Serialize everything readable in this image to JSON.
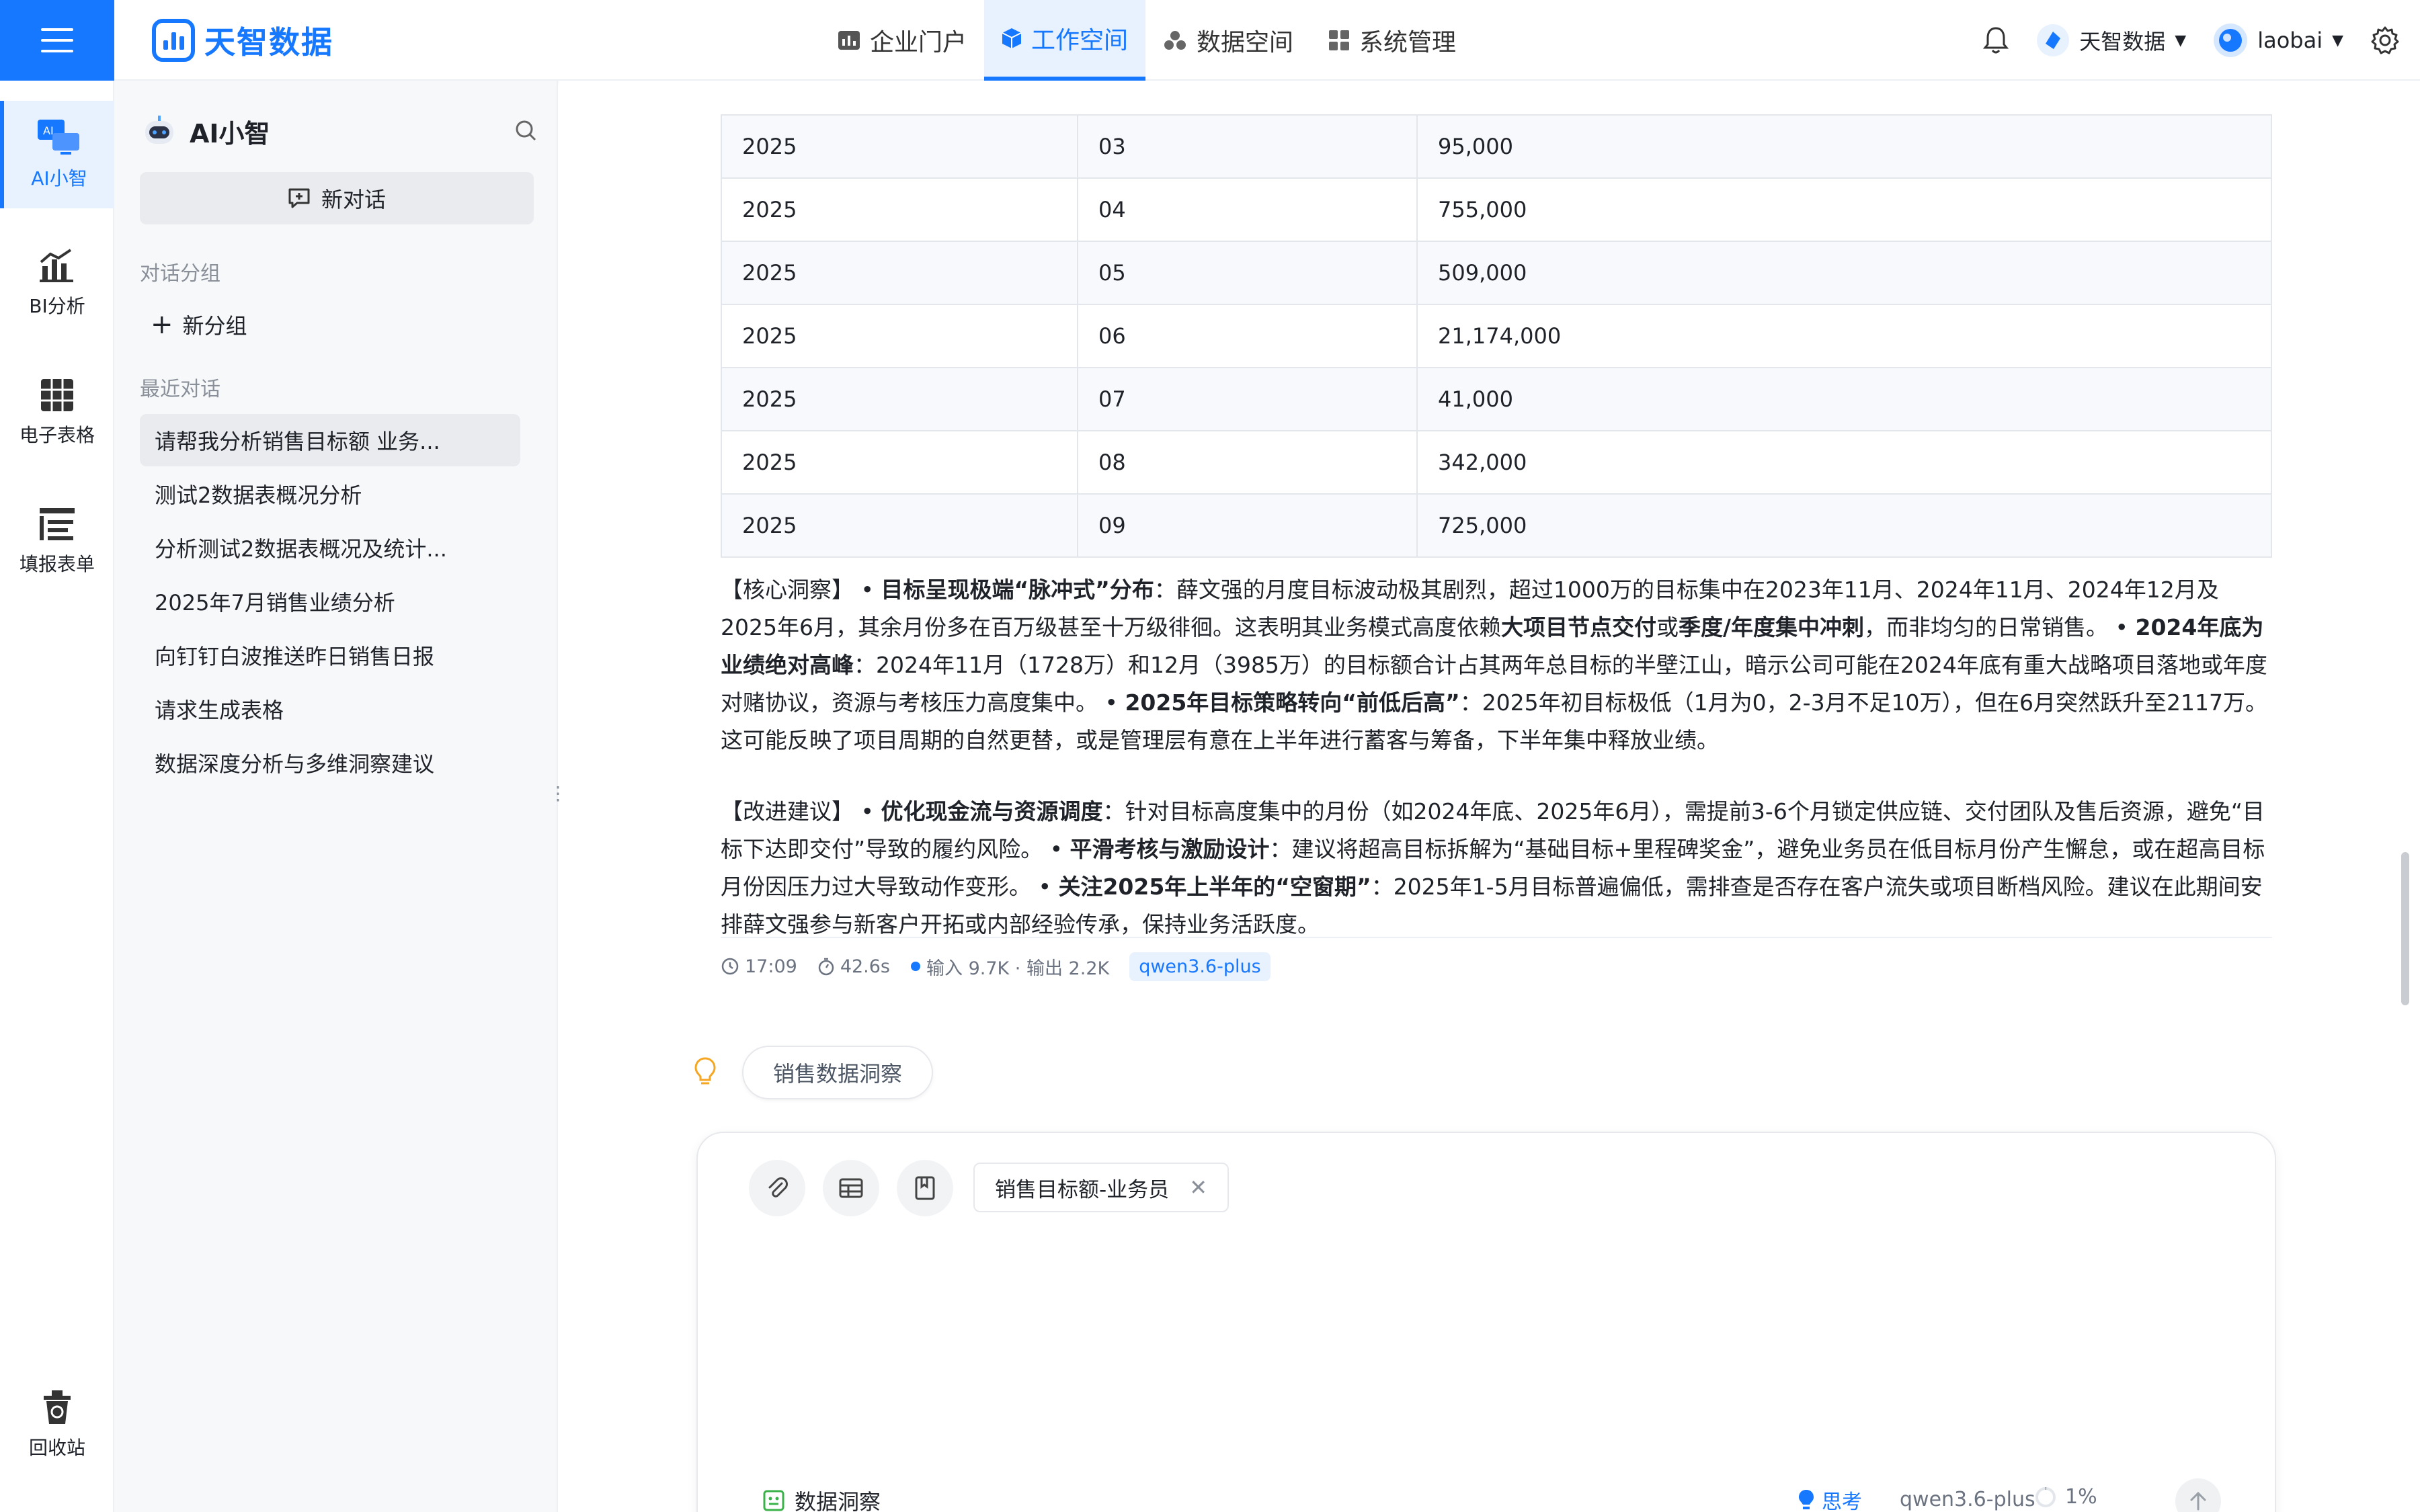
{
  "brand": {
    "name": "天智数据",
    "color": "#1677ff"
  },
  "nav": {
    "items": [
      {
        "label": "企业门户",
        "icon": "portal-icon"
      },
      {
        "label": "工作空间",
        "icon": "cube-icon",
        "active": true
      },
      {
        "label": "数据空间",
        "icon": "data-space-icon"
      },
      {
        "label": "系统管理",
        "icon": "grid-icon"
      }
    ]
  },
  "header_right": {
    "org": "天智数据",
    "user": "laobai"
  },
  "rail": {
    "items": [
      {
        "label": "AI小智",
        "icon": "ai-monitor-icon",
        "active": true
      },
      {
        "label": "BI分析",
        "icon": "bar-chart-icon"
      },
      {
        "label": "电子表格",
        "icon": "spreadsheet-icon"
      },
      {
        "label": "填报表单",
        "icon": "form-icon"
      }
    ],
    "recycle": "回收站"
  },
  "panel": {
    "title": "AI小智",
    "new_chat": "新对话",
    "group_label": "对话分组",
    "add_group": "新分组",
    "recent_label": "最近对话",
    "conversations": [
      "请帮我分析销售目标额 业务...",
      "测试2数据表概况分析",
      "分析测试2数据表概况及统计...",
      "2025年7月销售业绩分析",
      "向钉钉白波推送昨日销售日报",
      "请求生成表格",
      "数据深度分析与多维洞察建议"
    ]
  },
  "table": {
    "rows": [
      [
        "2025",
        "03",
        "95,000"
      ],
      [
        "2025",
        "04",
        "755,000"
      ],
      [
        "2025",
        "05",
        "509,000"
      ],
      [
        "2025",
        "06",
        "21,174,000"
      ],
      [
        "2025",
        "07",
        "41,000"
      ],
      [
        "2025",
        "08",
        "342,000"
      ],
      [
        "2025",
        "09",
        "725,000"
      ]
    ]
  },
  "insight": {
    "p1": [
      {
        "t": "【核心洞察】 • "
      },
      {
        "t": "目标呈现极端“脉冲式”分布",
        "b": true
      },
      {
        "t": "：薛文强的月度目标波动极其剧烈，超过1000万的目标集中在2023年11月、2024年11月、2024年12月及2025年6月，其余月份多在百万级甚至十万级徘徊。这表明其业务模式高度依赖"
      },
      {
        "t": "大项目节点交付",
        "b": true
      },
      {
        "t": "或"
      },
      {
        "t": "季度/年度集中冲刺",
        "b": true
      },
      {
        "t": "，而非均匀的日常销售。 • "
      },
      {
        "t": "2024年底为业绩绝对高峰",
        "b": true
      },
      {
        "t": "：2024年11月（1728万）和12月（3985万）的目标额合计占其两年总目标的半壁江山，暗示公司可能在2024年底有重大战略项目落地或年度对赌协议，资源与考核压力高度集中。 • "
      },
      {
        "t": "2025年目标策略转向“前低后高”",
        "b": true
      },
      {
        "t": "：2025年初目标极低（1月为0，2-3月不足10万），但在6月突然跃升至2117万。这可能反映了项目周期的自然更替，或是管理层有意在上半年进行蓄客与筹备，下半年集中释放业绩。"
      }
    ],
    "p2": [
      {
        "t": "【改进建议】 • "
      },
      {
        "t": "优化现金流与资源调度",
        "b": true
      },
      {
        "t": "：针对目标高度集中的月份（如2024年底、2025年6月），需提前3-6个月锁定供应链、交付团队及售后资源，避免“目标下达即交付”导致的履约风险。 • "
      },
      {
        "t": "平滑考核与激励设计",
        "b": true
      },
      {
        "t": "：建议将超高目标拆解为“基础目标+里程碑奖金”，避免业务员在低目标月份产生懈怠，或在超高目标月份因压力过大导致动作变形。 • "
      },
      {
        "t": "关注2025年上半年的“空窗期”",
        "b": true
      },
      {
        "t": "：2025年1-5月目标普遍偏低，需排查是否存在客户流失或项目断档风险。建议在此期间安排薛文强参与新客户开拓或内部经验传承，保持业务活跃度。"
      }
    ]
  },
  "meta": {
    "time": "17:09",
    "duration": "42.6s",
    "tokens": "输入 9.7K · 输出 2.2K",
    "model": "qwen3.6-plus"
  },
  "suggestion": "销售数据洞察",
  "composer": {
    "chip": "销售目标额-业务员",
    "insight_label": "数据洞察",
    "think_label": "思考",
    "model": "qwen3.6-plus",
    "percent": "1%"
  }
}
